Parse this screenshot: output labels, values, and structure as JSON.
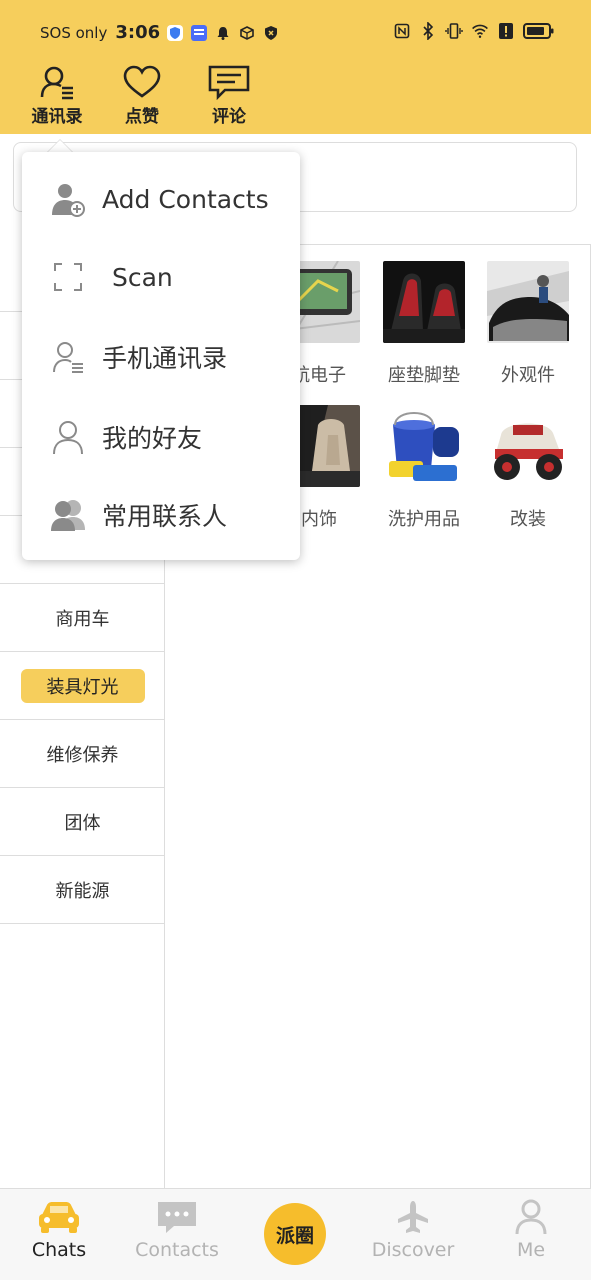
{
  "status_bar": {
    "carrier": "SOS only",
    "time": "3:06"
  },
  "header": {
    "contacts_label": "通讯录",
    "likes_label": "点赞",
    "comments_label": "评论"
  },
  "popup_menu": {
    "items": [
      {
        "label": "Add Contacts",
        "icon": "add-contact-icon"
      },
      {
        "label": "Scan",
        "icon": "scan-icon"
      },
      {
        "label": "手机通讯录",
        "icon": "phone-contacts-icon"
      },
      {
        "label": "我的好友",
        "icon": "friend-icon"
      },
      {
        "label": "常用联系人",
        "icon": "frequent-contacts-icon"
      }
    ]
  },
  "categories": [
    {
      "label": "商用车",
      "active": false
    },
    {
      "label": "装具灯光",
      "active": true
    },
    {
      "label": "维修保养",
      "active": false
    },
    {
      "label": "团体",
      "active": false
    },
    {
      "label": "新能源",
      "active": false
    }
  ],
  "grid": {
    "row1": [
      "航电子",
      "座垫脚垫",
      "外观件"
    ],
    "row2": [
      "内饰",
      "洗护用品",
      "改装"
    ]
  },
  "bottom_nav": {
    "chats": "Chats",
    "contacts": "Contacts",
    "center": "派圈",
    "discover": "Discover",
    "me": "Me"
  },
  "colors": {
    "accent": "#f6ce5c",
    "center_button": "#f6bd2c"
  }
}
